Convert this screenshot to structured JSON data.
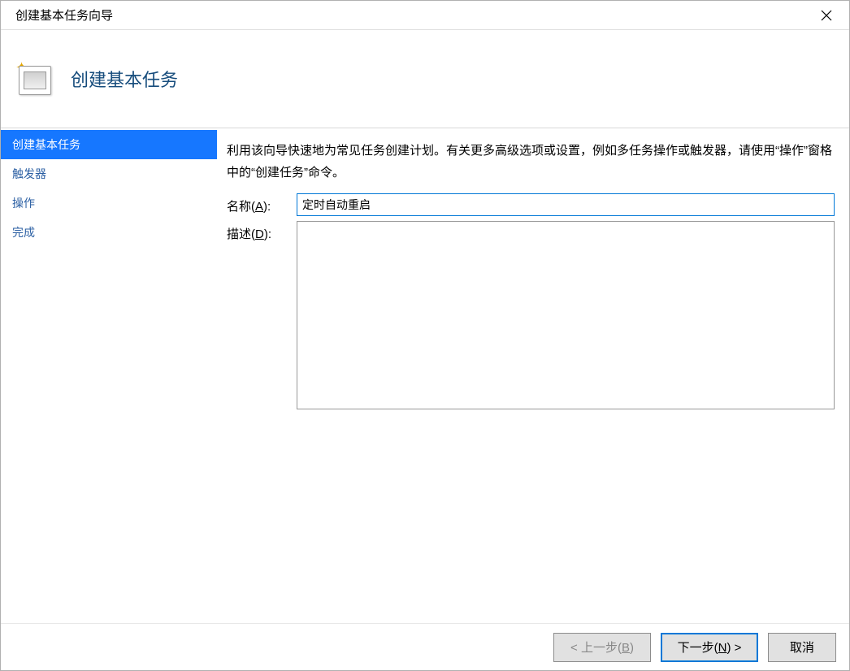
{
  "window": {
    "title": "创建基本任务向导"
  },
  "header": {
    "title": "创建基本任务"
  },
  "sidebar": {
    "items": [
      {
        "label": "创建基本任务",
        "selected": true
      },
      {
        "label": "触发器",
        "selected": false
      },
      {
        "label": "操作",
        "selected": false
      },
      {
        "label": "完成",
        "selected": false
      }
    ]
  },
  "main": {
    "description": "利用该向导快速地为常见任务创建计划。有关更多高级选项或设置，例如多任务操作或触发器，请使用“操作”窗格中的“创建任务”命令。",
    "name_label_prefix": "名称(",
    "name_label_underline": "A",
    "name_label_suffix": "):",
    "name_value": "定时自动重启",
    "desc_label_prefix": "描述(",
    "desc_label_underline": "D",
    "desc_label_suffix": "):",
    "desc_value": ""
  },
  "footer": {
    "back_prefix": "< 上一步(",
    "back_underline": "B",
    "back_suffix": ")",
    "next_prefix": "下一步(",
    "next_underline": "N",
    "next_suffix": ") >",
    "cancel": "取消"
  }
}
